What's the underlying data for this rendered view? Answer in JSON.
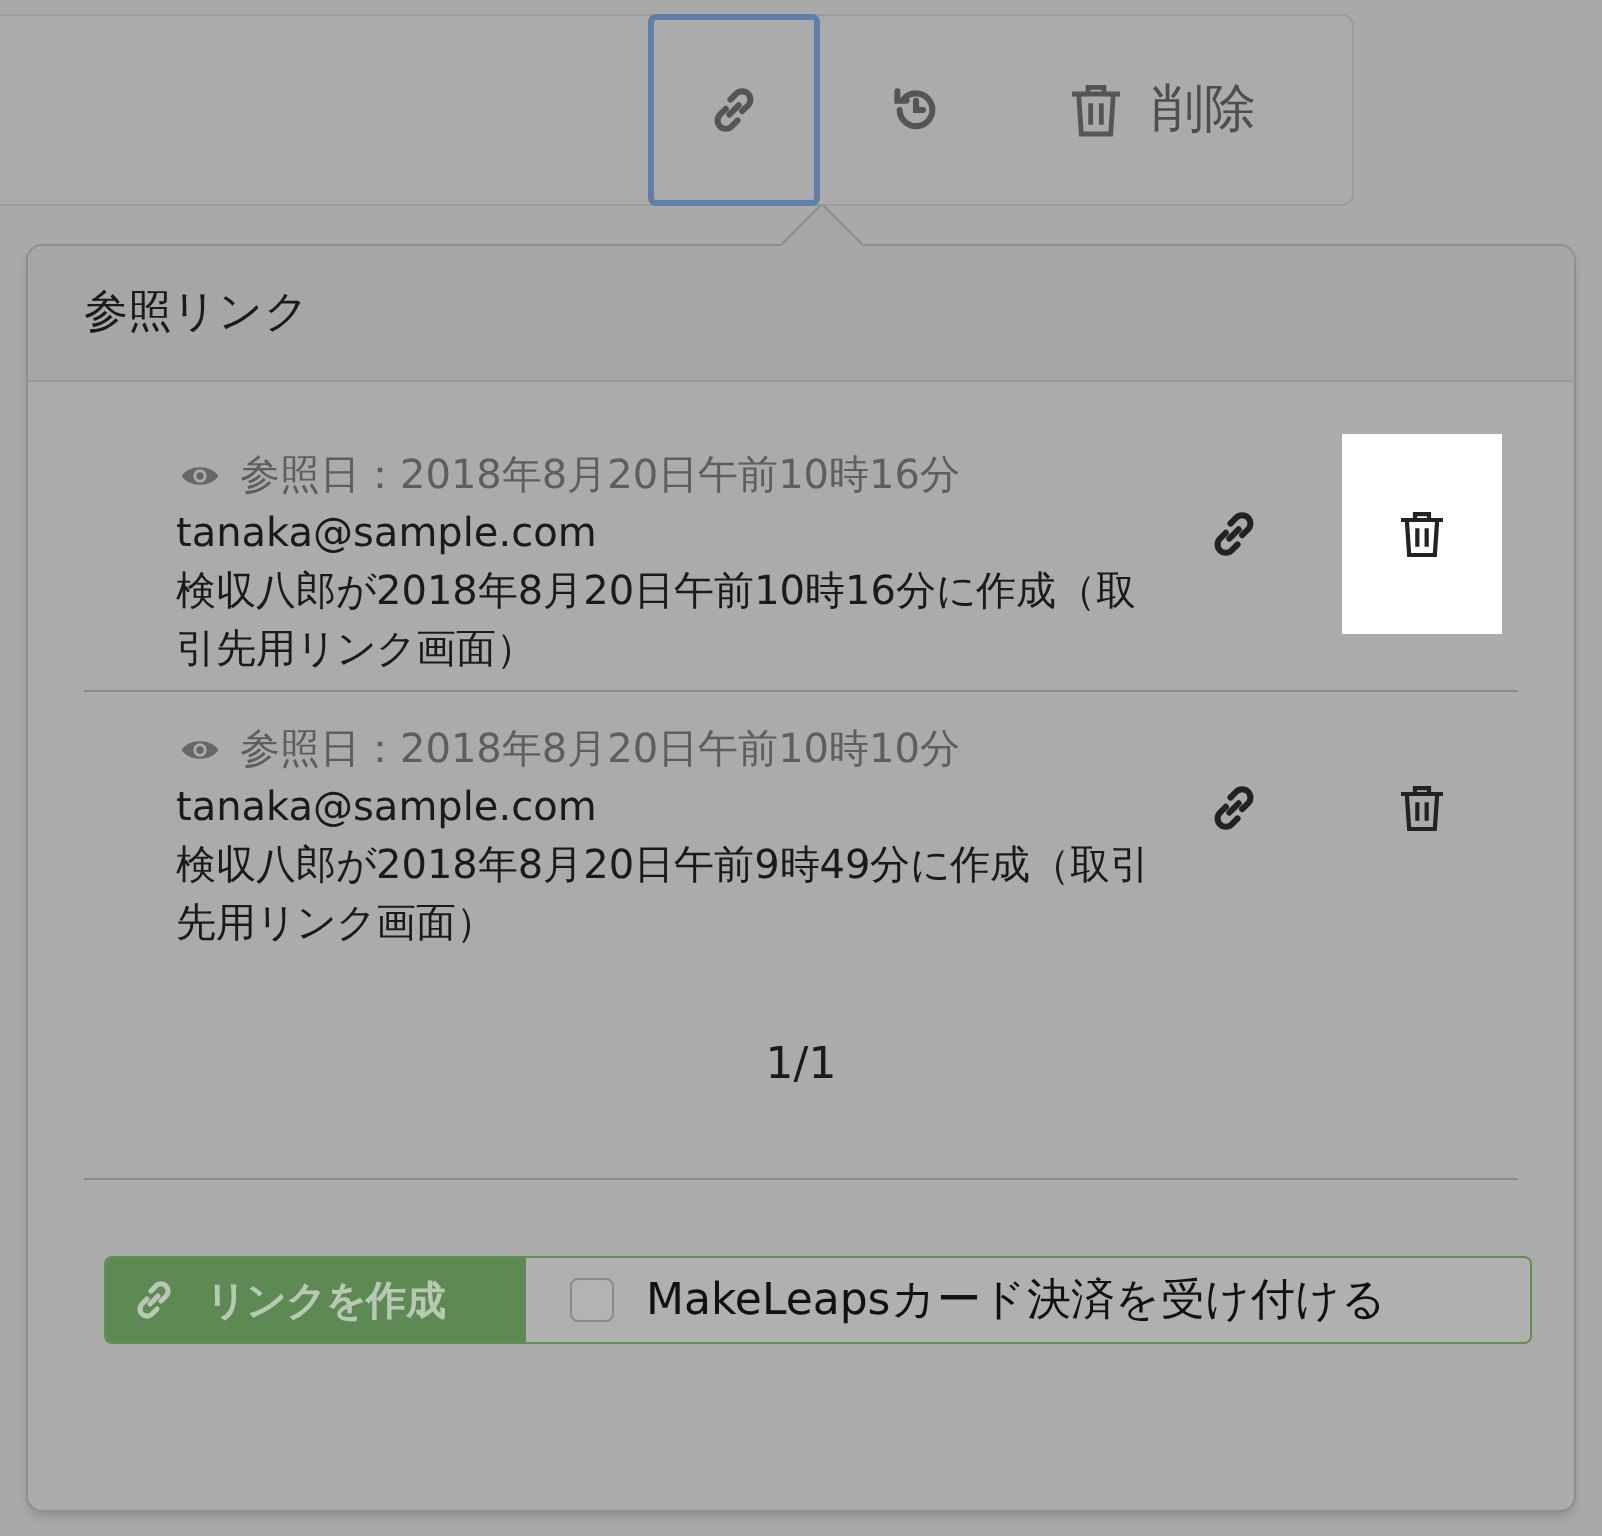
{
  "toolbar": {
    "buttons": [
      {
        "kind": "link",
        "selected": true
      },
      {
        "kind": "restore",
        "selected": false
      },
      {
        "kind": "delete",
        "label": "削除",
        "selected": false
      }
    ]
  },
  "popover": {
    "title": "参照リンク",
    "links": [
      {
        "viewed": "参照日：2018年8月20日午前10時16分",
        "email": "tanaka@sample.com",
        "description": "検収八郎が2018年8月20日午前10時16分に作成（取引先用リンク画面）",
        "delete_highlighted": true
      },
      {
        "viewed": "参照日：2018年8月20日午前10時10分",
        "email": "tanaka@sample.com",
        "description": "検収八郎が2018年8月20日午前9時49分に作成（取引先用リンク画面）",
        "delete_highlighted": false
      }
    ],
    "pagination": "1/1",
    "footer": {
      "create_label": "リンクを作成",
      "checkbox": {
        "label": "MakeLeapsカード決済を受け付ける",
        "checked": false
      }
    }
  }
}
